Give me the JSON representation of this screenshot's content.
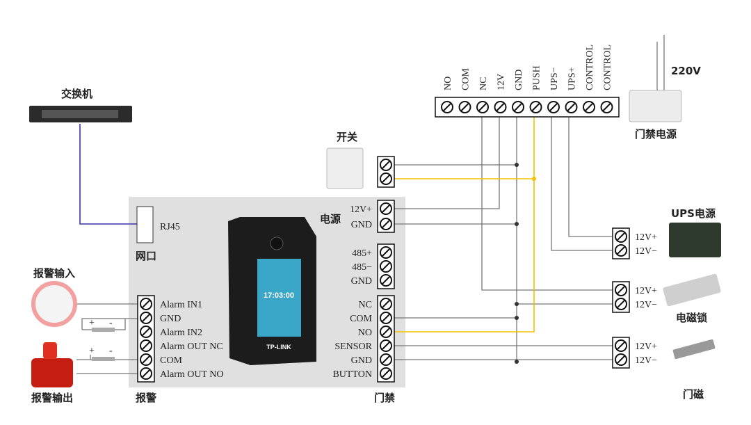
{
  "colors": {
    "panel": "#e0e0e0",
    "wire": "#777777",
    "push_wire": "#f2c200",
    "network_wire": "#3a32a8"
  },
  "labels": {
    "switch": "交换机",
    "rj45": "RJ45",
    "network_port": "网口",
    "power": "电源",
    "alarm": "报警",
    "access": "门禁",
    "alarm_input": "报警输入",
    "alarm_output": "报警输出",
    "exit_button": "开关",
    "door_power": "门禁电源",
    "mains": "220V",
    "ups": "UPS电源",
    "lock": "电磁锁",
    "door_sensor": "门磁",
    "brand": "TP-LINK",
    "clock": "17:03:00",
    "plus": "+",
    "minus": "-"
  },
  "top_terminals": [
    "NO",
    "COM",
    "NC",
    "12V",
    "GND",
    "PUSH",
    "UPS−",
    "UPS+",
    "CONTROL",
    "CONTROL"
  ],
  "power_terminals": [
    "12V+",
    "GND"
  ],
  "rs485_terminals": [
    "485+",
    "485−",
    "GND"
  ],
  "door_terminals": [
    "NC",
    "COM",
    "NO",
    "SENSOR",
    "GND",
    "BUTTON"
  ],
  "alarm_terminals": [
    "Alarm IN1",
    "GND",
    "Alarm IN2",
    "Alarm OUT NC",
    "COM",
    "Alarm OUT NO"
  ],
  "ups_terminals": [
    "12V+",
    "12V−"
  ],
  "lock_terminals": [
    "12V+",
    "12V−"
  ],
  "sensor_terminals": [
    "12V+",
    "12V−"
  ]
}
